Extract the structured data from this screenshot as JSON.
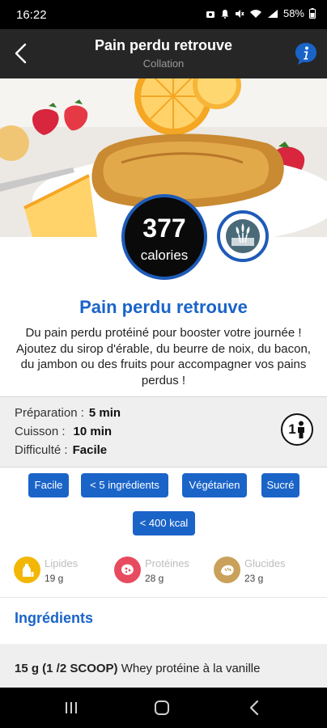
{
  "status_bar": {
    "time": "16:22",
    "battery": "58%"
  },
  "header": {
    "title": "Pain perdu retrouve",
    "subtitle": "Collation"
  },
  "hero": {
    "image_subject": "french-toast-with-oranges-and-strawberries",
    "calories_value": "377",
    "calories_label": "calories",
    "category_icon": "vegetarian-wheat-icon"
  },
  "recipe": {
    "title": "Pain perdu retrouve",
    "description": "Du pain perdu protéiné pour booster votre journée ! Ajoutez du sirop d'érable, du beurre de noix, du bacon, du jambon ou des fruits pour accompagner vos pains perdus !"
  },
  "info": {
    "preparation_label": "Préparation :",
    "preparation_value": "5 min",
    "cuisson_label": "Cuisson :",
    "cuisson_value": "10 min",
    "difficulte_label": "Difficulté :",
    "difficulte_value": "Facile",
    "persons": "1"
  },
  "tags": [
    "Facile",
    "< 5 ingrédients",
    "Végétarien",
    "Sucré",
    "< 400 kcal"
  ],
  "macros": [
    {
      "label": "Lipides",
      "value": "19 g",
      "color": "#f2b705",
      "icon": "oil-bottle-icon"
    },
    {
      "label": "Protéines",
      "value": "28 g",
      "color": "#e84a5f",
      "icon": "meat-icon"
    },
    {
      "label": "Glucides",
      "value": "23 g",
      "color": "#c9a15a",
      "icon": "bread-icon"
    }
  ],
  "ingredients": {
    "section_title": "Ingrédients",
    "items": [
      {
        "quantity": "15 g (1 /2 SCOOP)",
        "name": "Whey protéine à la vanille"
      }
    ]
  },
  "colors": {
    "accent": "#1a64c8",
    "app_bar": "#262626",
    "badge_bg": "#0a0a0a"
  },
  "nav": {
    "recents": "recents-icon",
    "home": "home-icon",
    "back": "back-icon"
  }
}
